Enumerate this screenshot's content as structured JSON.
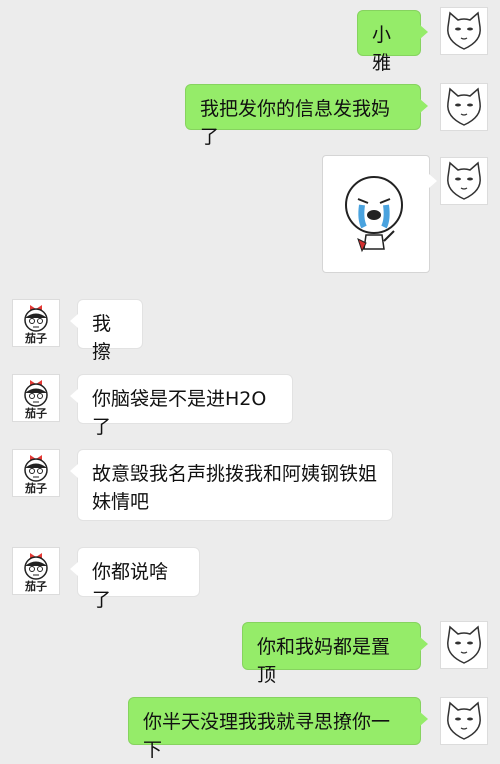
{
  "messages": [
    {
      "side": "right",
      "type": "text",
      "text": "小雅"
    },
    {
      "side": "right",
      "type": "text",
      "text": "我把发你的信息发我妈了"
    },
    {
      "side": "right",
      "type": "sticker",
      "icon": "crying-face-sticker"
    },
    {
      "side": "left",
      "type": "text",
      "text": "我擦"
    },
    {
      "side": "left",
      "type": "text",
      "text": "你脑袋是不是进H2O了"
    },
    {
      "side": "left",
      "type": "text",
      "text": "故意毁我名声挑拨我和阿姨钢铁姐妹情吧"
    },
    {
      "side": "left",
      "type": "text",
      "text": "你都说啥了"
    },
    {
      "side": "right",
      "type": "text",
      "text": "你和我妈都是置顶"
    },
    {
      "side": "right",
      "type": "text",
      "text": "你半天没理我我就寻思撩你一下"
    }
  ],
  "avatars": {
    "me": {
      "icon": "cat-face-avatar-icon"
    },
    "friend": {
      "icon": "girl-with-bow-avatar-icon",
      "label": "茄子"
    }
  },
  "colors": {
    "sent_bubble": "#95ec69",
    "received_bubble": "#ffffff",
    "background": "#ececec"
  }
}
